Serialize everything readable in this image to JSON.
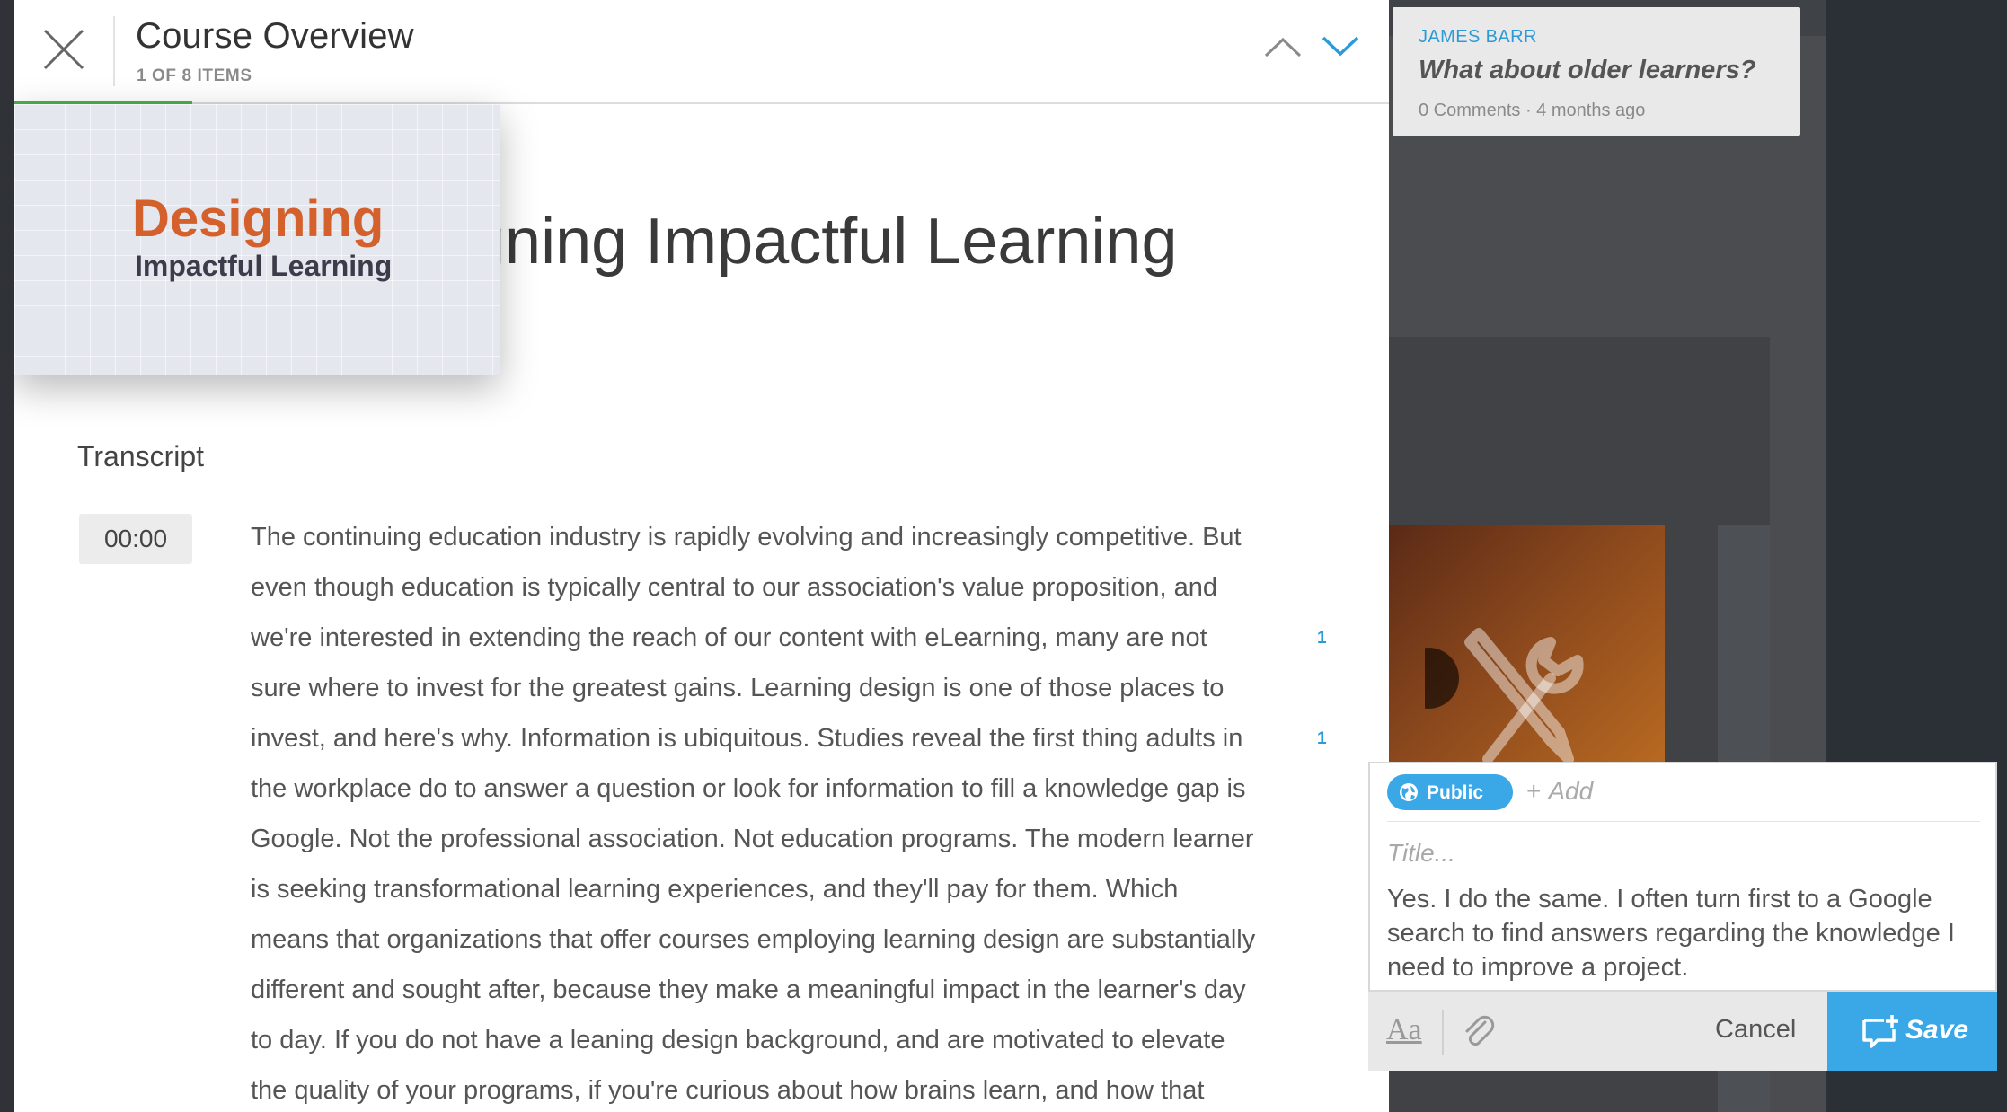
{
  "header": {
    "title": "Course Overview",
    "subtitle": "1 OF 8 ITEMS",
    "progress_fraction": 0.125
  },
  "course": {
    "title": "Designing Impactful Learning",
    "visible_title": "igning Impactful Learning",
    "thumbnail": {
      "word1": "Designing",
      "word2": "Impactful Learning"
    }
  },
  "transcript": {
    "heading": "Transcript",
    "timestamp": "00:00",
    "lines": [
      "The continuing education industry is rapidly evolving and increasingly competitive. But",
      "even though education is typically central to our association's value proposition, and",
      "we're interested in extending the reach of our content with eLearning, many are not",
      "sure where to invest for the greatest gains. Learning design is one of those places to",
      "invest, and here's why. Information is ubiquitous. Studies reveal the first thing adults in",
      "the workplace do to answer a question or look for information to fill a knowledge gap is",
      "Google. Not the professional association. Not education programs. The modern learner",
      "is seeking transformational learning experiences, and they'll pay for them. Which",
      "means that organizations that offer courses employing learning design are substantially",
      "different and sought after, because they make a meaningful impact in the learner's day",
      "to day. If you do not have a leaning design background, and are motivated to elevate",
      "the quality of your programs, if you're curious about how brains learn, and how that"
    ],
    "note_counts": [
      {
        "line": 3,
        "count": "1"
      },
      {
        "line": 5,
        "count": "1"
      }
    ]
  },
  "note_card": {
    "author": "JAMES BARR",
    "title": "What about older learners?",
    "comments": "0 Comments",
    "time": "4 months ago",
    "separator": "·"
  },
  "editor": {
    "visibility": "Public",
    "add_label": "Add",
    "title_placeholder": "Title...",
    "body_lines": [
      "Yes. I do the same. I often turn first to a Google",
      "search to find answers regarding the knowledge I",
      "need to improve a project."
    ],
    "format_label": "Aa",
    "cancel_label": "Cancel",
    "save_label": "Save"
  },
  "colors": {
    "accent_blue": "#3aa7e6",
    "progress_green": "#4cb050",
    "thumb_orange": "#d4602c"
  },
  "icons": [
    "close-icon",
    "chevron-up-icon",
    "chevron-down-icon",
    "globe-icon",
    "paperclip-icon",
    "add-note-icon",
    "tools-icon"
  ]
}
